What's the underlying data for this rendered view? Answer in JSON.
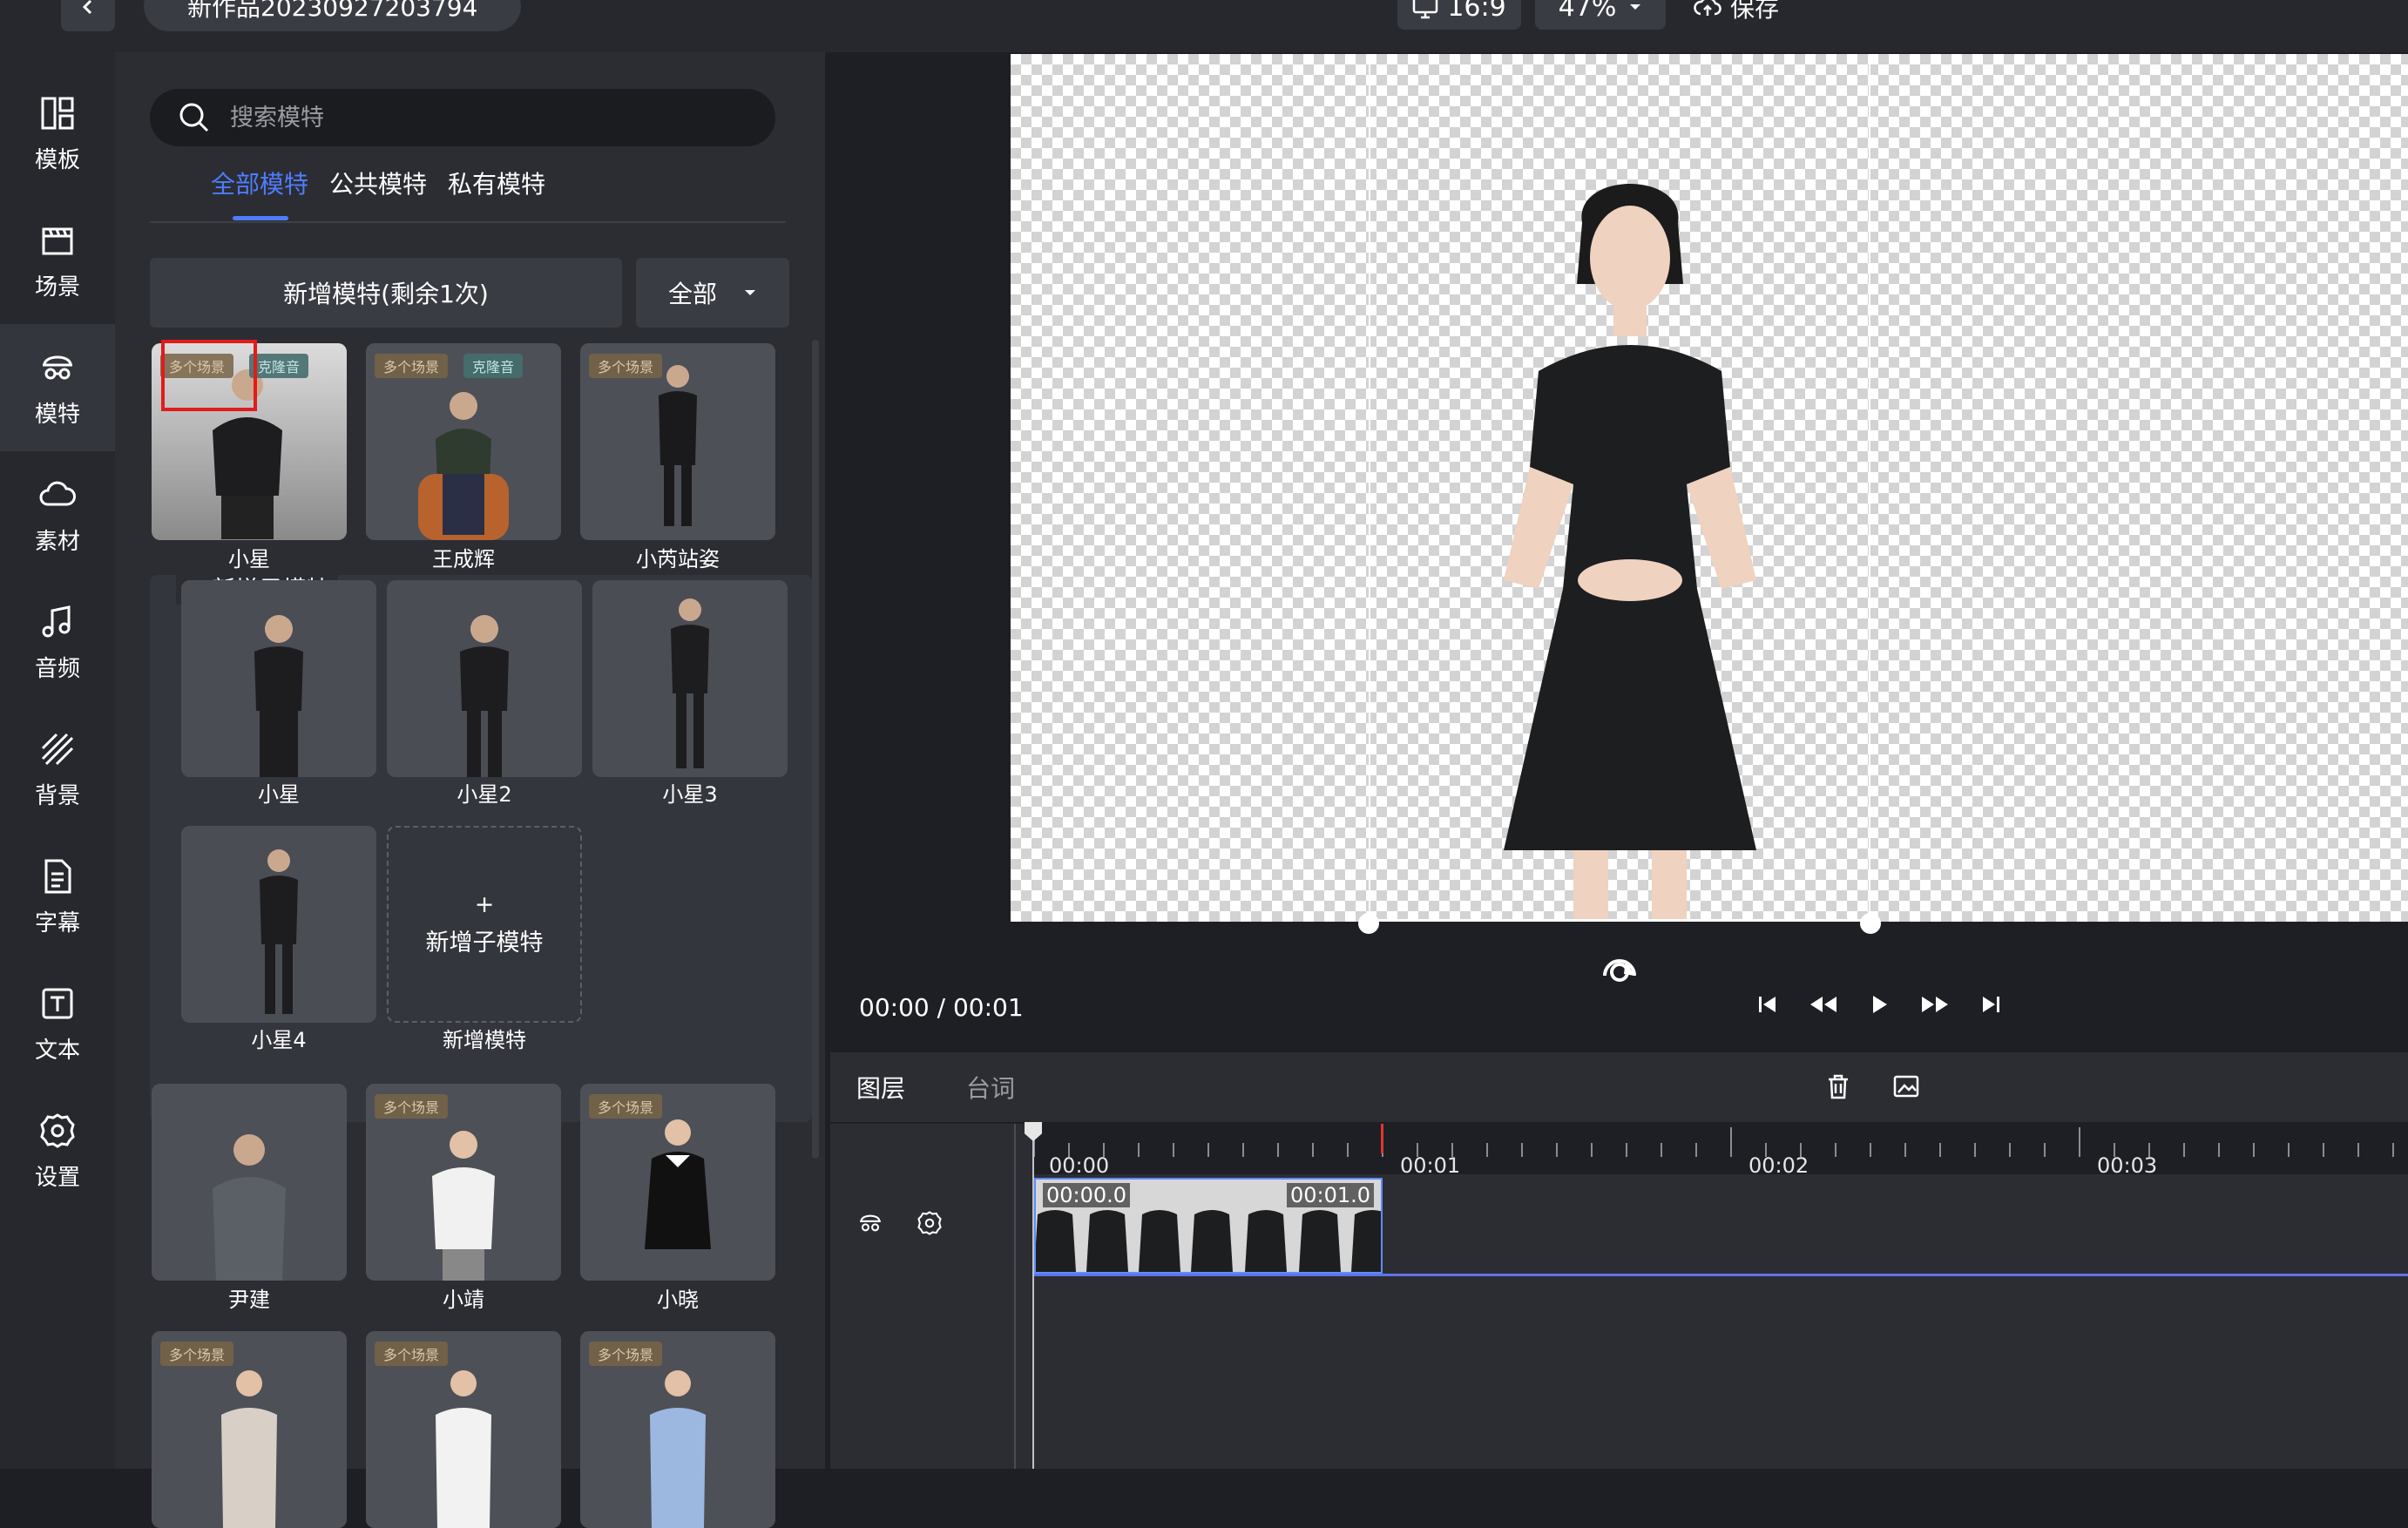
{
  "topbar": {
    "back_icon": "chevron-left-icon",
    "project_title": "新作品20230927203794",
    "aspect_ratio": "16:9",
    "zoom": "47%",
    "save_label": "保存"
  },
  "nav": [
    {
      "label": "模板",
      "icon": "template-icon"
    },
    {
      "label": "场景",
      "icon": "scene-icon"
    },
    {
      "label": "模特",
      "icon": "model-icon"
    },
    {
      "label": "素材",
      "icon": "cloud-icon"
    },
    {
      "label": "音频",
      "icon": "music-icon"
    },
    {
      "label": "背景",
      "icon": "background-icon"
    },
    {
      "label": "字幕",
      "icon": "subtitle-icon"
    },
    {
      "label": "文本",
      "icon": "text-icon"
    },
    {
      "label": "设置",
      "icon": "gear-icon"
    }
  ],
  "panel": {
    "search_placeholder": "搜索模特",
    "tabs": [
      "全部模特",
      "公共模特",
      "私有模特"
    ],
    "add_button": "新增模特(剩余1次)",
    "filter_value": "全部",
    "models_row1": [
      {
        "name": "小星",
        "badges": [
          "多个场景",
          "克隆音"
        ]
      },
      {
        "name": "王成辉",
        "badges": [
          "多个场景",
          "克隆音"
        ]
      },
      {
        "name": "小芮站姿",
        "badges": [
          "多个场景"
        ]
      }
    ],
    "sub_models_label": "+ 新增子模特",
    "sub_models": [
      {
        "name": "小星"
      },
      {
        "name": "小星2"
      },
      {
        "name": "小星3"
      },
      {
        "name": "小星4"
      }
    ],
    "add_sub_plus": "+",
    "add_sub_text": "新增子模特",
    "add_sub_caption": "新增模特",
    "models_row2": [
      {
        "name": "尹建",
        "badges": []
      },
      {
        "name": "小靖",
        "badges": [
          "多个场景"
        ]
      },
      {
        "name": "小晓",
        "badges": [
          "多个场景"
        ]
      }
    ],
    "models_row3": [
      {
        "name": "",
        "badges": [
          "多个场景"
        ]
      },
      {
        "name": "",
        "badges": [
          "多个场景"
        ]
      },
      {
        "name": "",
        "badges": [
          "多个场景"
        ]
      }
    ]
  },
  "player": {
    "current_time": "00:00",
    "separator": "/",
    "total_time": "00:01"
  },
  "timeline": {
    "tabs": [
      "图层",
      "台词"
    ],
    "ruler_labels": [
      "00:00",
      "00:01",
      "00:02",
      "00:03"
    ],
    "clip_start_label": "00:00.0",
    "clip_end_label": "00:01.0"
  },
  "colors": {
    "accent": "#4f7cff",
    "highlight": "#e21b1b"
  }
}
